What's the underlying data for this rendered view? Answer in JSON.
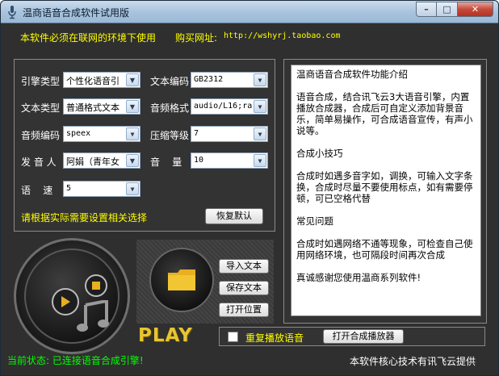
{
  "window": {
    "title": "温商语音合成软件试用版",
    "minimize_label": "–",
    "maximize_label": "□",
    "close_label": "✕"
  },
  "info": {
    "warning": "本软件必须在联网的环境下使用",
    "buy_label": "购买网址:",
    "buy_url": "http://wshyrj.taobao.com"
  },
  "settings": {
    "engine_type": {
      "label": "引擎类型",
      "value": "个性化语音引"
    },
    "text_encoding": {
      "label": "文本编码",
      "value": "GB2312"
    },
    "text_type": {
      "label": "文本类型",
      "value": "普通格式文本"
    },
    "audio_format": {
      "label": "音频格式",
      "value": "audio/L16;ra"
    },
    "audio_encoding": {
      "label": "音频编码",
      "value": "speex"
    },
    "compression": {
      "label": "压缩等级",
      "value": "7"
    },
    "speaker": {
      "label": "发 音 人",
      "value": "阿娟（青年女"
    },
    "volume": {
      "label": "音    量",
      "value": "10"
    },
    "speed": {
      "label": "语    速",
      "value": "5"
    },
    "hint": "请根据实际需要设置相关选择",
    "reset_label": "恢复默认"
  },
  "textbox": {
    "lines": [
      "温商语音合成软件功能介绍",
      "",
      "语音合成，结合讯飞云3大语音引擎，内置播放合成器，合成后可自定义添加背景音乐，简单易操作，可合成语音宣传，有声小说等。",
      "",
      "合成小技巧",
      "",
      "合成时如遇多音字如，调换，可输入文字条换，合成时尽量不要使用标点，如有需要停顿，可已空格代替",
      "",
      "常见问题",
      "",
      "合成时如遇网络不通等现象，可检查自己使用网络环境，也可隔段时间再次合成",
      "",
      "真诚感谢您使用温商系列软件!"
    ]
  },
  "actions": {
    "import_label": "导入文本",
    "save_label": "保存文本",
    "open_location_label": "打开位置",
    "play_logo": "PLAY",
    "repeat_label": "重复播放语音",
    "open_player_label": "打开合成播放器"
  },
  "status": {
    "current": "当前状态: 已连接语音合成引擎!",
    "credit": "本软件核心技术有讯飞云提供"
  },
  "colors": {
    "background": "#2f2f2f",
    "highlight_text": "#ffff00",
    "status_ok": "#00ff00",
    "logo_gold": "#e8c530"
  }
}
